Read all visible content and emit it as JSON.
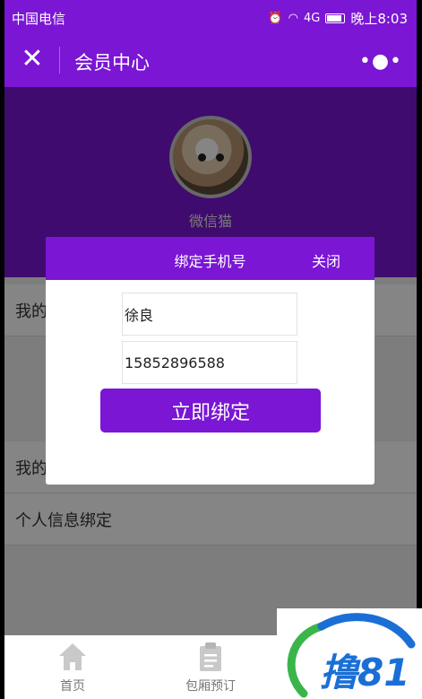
{
  "status_bar": {
    "carrier": "中国电信",
    "time": "晚上8:03",
    "signal": "4G"
  },
  "nav": {
    "title": "会员中心",
    "close_icon": "close-icon",
    "more_icon": "more-icon"
  },
  "profile": {
    "nickname": "微信猫"
  },
  "menu": {
    "items": [
      {
        "label": "我的"
      },
      {
        "label": "我的"
      },
      {
        "label": "个人信息绑定"
      }
    ]
  },
  "dialog": {
    "title": "绑定手机号",
    "close_label": "关闭",
    "name_value": "徐良",
    "phone_value": "15852896588",
    "bind_label": "立即绑定"
  },
  "tabs": [
    {
      "label": "首页",
      "icon": "home-icon"
    },
    {
      "label": "包厢预订",
      "icon": "clipboard-icon"
    }
  ],
  "watermark": {
    "text": "撸81"
  },
  "colors": {
    "accent": "#7a16d4",
    "watermark_blue": "#1a6fd6",
    "watermark_green": "#3ab54a"
  }
}
